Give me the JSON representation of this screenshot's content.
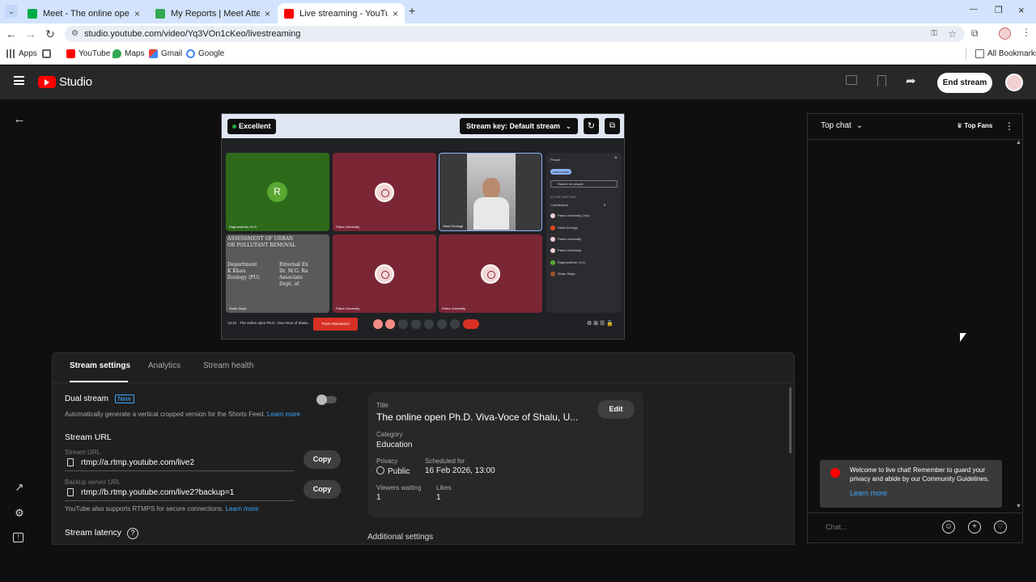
{
  "browser": {
    "tabs": [
      {
        "title": "Meet - The online open Ph.D. V",
        "icon": "meet-icon",
        "color": "#00ac47"
      },
      {
        "title": "My Reports | Meet Attendance",
        "icon": "attendance-icon",
        "color": "#34a853"
      },
      {
        "title": "Live streaming - YouTube Studi",
        "icon": "youtube-icon",
        "color": "#ff0000"
      }
    ],
    "url": "studio.youtube.com/video/Yq3VOn1cKeo/livestreaming",
    "bookmarks": [
      "Apps",
      "YouTube",
      "Maps",
      "Gmail",
      "Google"
    ],
    "all_bookmarks": "All Bookmarks"
  },
  "studio": {
    "logo": "Studio",
    "end_stream": "End stream"
  },
  "preview": {
    "quality": "Excellent",
    "stream_key": "Stream key: Default stream",
    "tiles": [
      {
        "name": "Raghunathan, M.G.",
        "initial": "R",
        "bg": "#2d6a1a"
      },
      {
        "name": "Patna University",
        "bg": "#7b2635"
      },
      {
        "name": "Head Zoology",
        "bg": "#3a3a3a"
      },
      {
        "name": "Shalu Singh",
        "bg": "#555"
      },
      {
        "name": "Patna University",
        "bg": "#7b2635"
      },
      {
        "name": "Patna University",
        "bg": "#7b2635"
      }
    ],
    "board_text": [
      "ASSESSMENT OF URBAN",
      "OR POLLUTANT REMOVAL",
      "Department",
      "K Khan",
      "Zoology (PU)",
      "External Ex",
      "Dr. M.G. Ra",
      "Associate",
      "Dept. of"
    ],
    "people": {
      "title": "People",
      "add": "Add people",
      "search": "Search for people",
      "section": "IN THE MEETING",
      "contributors": "Contributors",
      "count": "6",
      "list": [
        "Patna University (You)",
        "Head Zoology",
        "Patna University",
        "Patna University",
        "Raghunathan, M.G.",
        "Shalu Singh"
      ]
    },
    "footer_time": "13:12",
    "footer_title": "The online open Ph.D. Viva-Voce of Shalu...",
    "attendance_btn": "Track Attendance"
  },
  "settings": {
    "tabs": [
      "Stream settings",
      "Analytics",
      "Stream health"
    ],
    "dual_stream": "Dual stream",
    "new_badge": "New",
    "dual_desc": "Automatically generate a vertical cropped version for the Shorts Feed.",
    "learn_more": "Learn more",
    "stream_url_heading": "Stream URL",
    "stream_url_label": "Stream URL",
    "stream_url": "rtmp://a.rtmp.youtube.com/live2",
    "backup_label": "Backup server URL",
    "backup_url": "rtmp://b.rtmp.youtube.com/live2?backup=1",
    "rtmps_note": "YouTube also supports RTMPS for secure connections.",
    "copy": "Copy",
    "latency": "Stream latency",
    "additional": "Additional settings"
  },
  "info": {
    "title_label": "Title",
    "title": "The online open Ph.D. Viva-Voce of Shalu, U...",
    "edit": "Edit",
    "category_label": "Category",
    "category": "Education",
    "privacy_label": "Privacy",
    "privacy": "Public",
    "scheduled_label": "Scheduled for",
    "scheduled": "16 Feb 2026, 13:00",
    "viewers_label": "Viewers waiting",
    "viewers": "1",
    "likes_label": "Likes",
    "likes": "1"
  },
  "chat": {
    "mode": "Top chat",
    "top_fans": "Top Fans",
    "notice": "Welcome to live chat! Remember to guard your privacy and abide by our Community Guidelines.",
    "learn_more": "Learn more",
    "placeholder": "Chat..."
  },
  "colors": {
    "accent": "#3ea6ff",
    "brand": "#ff0000",
    "quality_dot": "#2ba640"
  }
}
